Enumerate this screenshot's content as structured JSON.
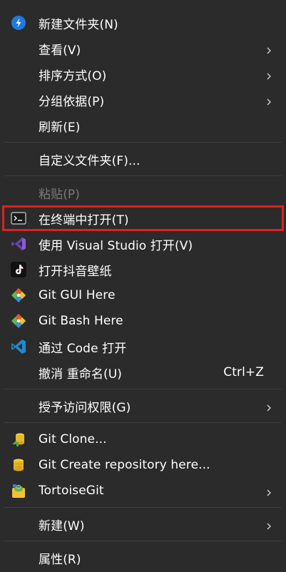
{
  "menu": {
    "new_folder": "新建文件夹(N)",
    "view": "查看(V)",
    "sort": "排序方式(O)",
    "group": "分组依据(P)",
    "refresh": "刷新(E)",
    "customize": "自定义文件夹(F)...",
    "paste": "粘贴(P)",
    "open_terminal": "在终端中打开(T)",
    "open_vs": "使用 Visual Studio 打开(V)",
    "open_douyin": "打开抖音壁纸",
    "git_gui": "Git GUI Here",
    "git_bash": "Git Bash Here",
    "open_code": "通过 Code 打开",
    "undo_rename": "撤消 重命名(U)",
    "undo_shortcut": "Ctrl+Z",
    "grant_access": "授予访问权限(G)",
    "git_clone": "Git Clone...",
    "git_create": "Git Create repository here...",
    "tortoisegit": "TortoiseGit",
    "new": "新建(W)",
    "properties": "属性(R)"
  },
  "colors": {
    "background": "#2b2b2b",
    "separator": "#3d3d3d",
    "highlight": "#e02020",
    "disabled_text": "#7a7a7a"
  }
}
